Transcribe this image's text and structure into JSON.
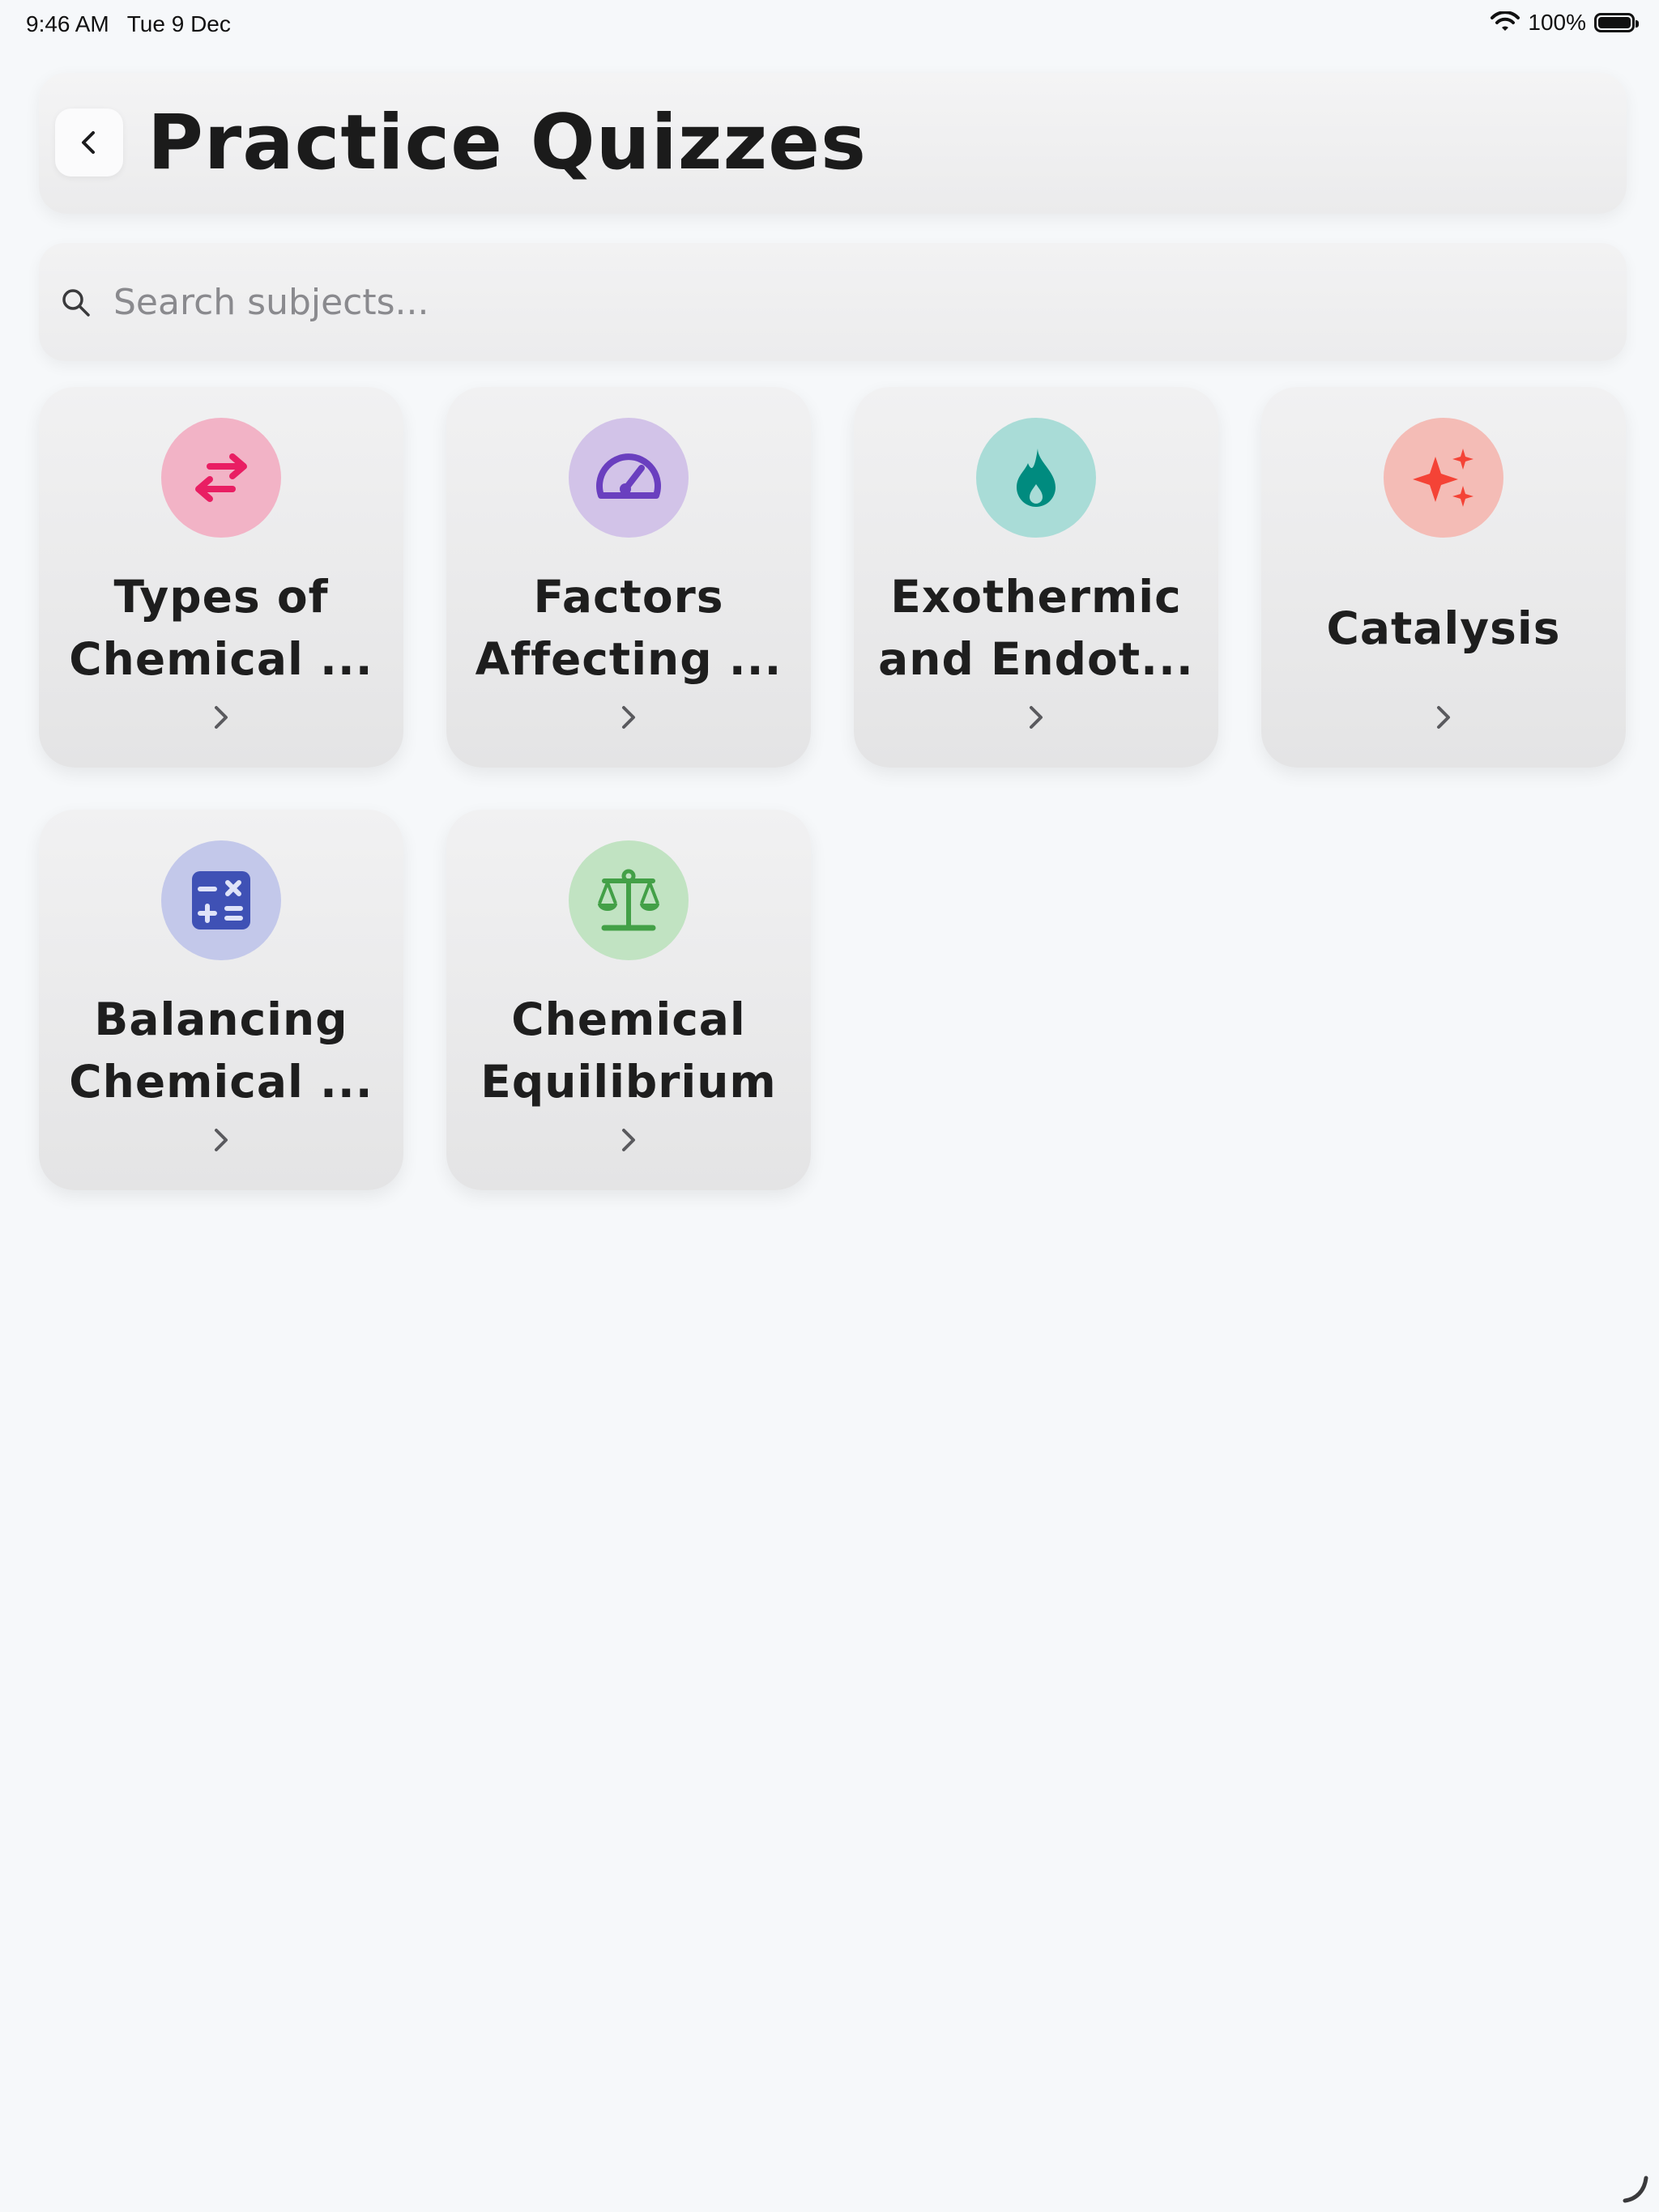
{
  "status_bar": {
    "time": "9:46 AM",
    "date": "Tue 9 Dec",
    "battery": "100%",
    "battery_level": 1.0
  },
  "header": {
    "title": "Practice Quizzes",
    "back_icon": "chevron-left-icon"
  },
  "search": {
    "placeholder": "Search subjects...",
    "value": "",
    "icon": "search-icon"
  },
  "quizzes": [
    {
      "title": "Types of Chemical ...",
      "icon": "swap-arrows-icon",
      "icon_color": "#e91e63",
      "circle_color": "#f2b3c6"
    },
    {
      "title": "Factors Affecting ...",
      "icon": "speedometer-icon",
      "icon_color": "#6a3fbf",
      "circle_color": "#d2c3e8"
    },
    {
      "title": "Exothermic and Endot...",
      "icon": "fire-icon",
      "icon_color": "#008b7f",
      "circle_color": "#a9dcd7"
    },
    {
      "title": "Catalysis",
      "icon": "sparkles-icon",
      "icon_color": "#f44336",
      "circle_color": "#f4bcb6"
    },
    {
      "title": "Balancing Chemical ...",
      "icon": "calculator-icon",
      "icon_color": "#3f51b5",
      "circle_color": "#c3c8ea"
    },
    {
      "title": "Chemical Equilibrium",
      "icon": "balance-scale-icon",
      "icon_color": "#43a047",
      "circle_color": "#c1e3c2"
    }
  ]
}
